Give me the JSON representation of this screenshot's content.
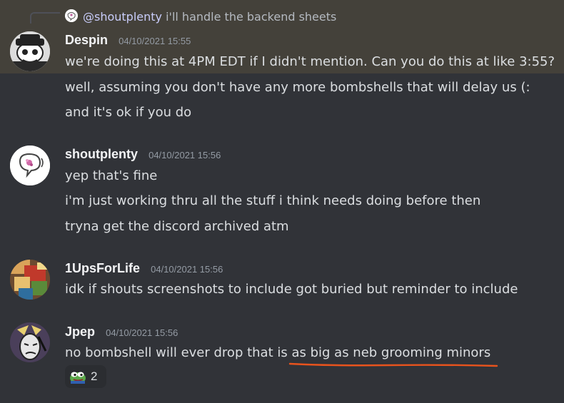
{
  "reply": {
    "mention": "@shoutplenty",
    "text": "i'll handle the backend sheets"
  },
  "messages": [
    {
      "username": "Despin",
      "timestamp": "04/10/2021 15:55",
      "avatar_icon": "skull-cartoon-avatar",
      "lines": [
        "we're doing this at 4PM EDT if I didn't mention. Can you do this at like 3:55?",
        "well, assuming you don't have any more bombshells that will delay us (:",
        "and it's ok if you do"
      ]
    },
    {
      "username": "shoutplenty",
      "timestamp": "04/10/2021 15:56",
      "avatar_icon": "speech-bubble-avatar",
      "lines": [
        "yep that's fine",
        "i'm just working thru all the stuff i think needs doing before then",
        "tryna get the discord archived atm"
      ]
    },
    {
      "username": "1UpsForLife",
      "timestamp": "04/10/2021 15:56",
      "avatar_icon": "colorful-pixel-avatar",
      "lines": [
        "idk if shouts screenshots to include got buried but reminder to include"
      ]
    },
    {
      "username": "Jpep",
      "timestamp": "04/10/2021 15:56",
      "avatar_icon": "sketch-face-avatar",
      "line_prefix": "no bombshell will ever drop that is ",
      "line_underlined": "as big as neb grooming minors",
      "reaction": {
        "emoji": "pepe-frog-icon",
        "count": "2"
      }
    }
  ],
  "colors": {
    "background": "#313338",
    "highlight": "#44413a",
    "underline": "#e8531d",
    "username": "#f2f3f5",
    "timestamp": "#949ba4"
  }
}
